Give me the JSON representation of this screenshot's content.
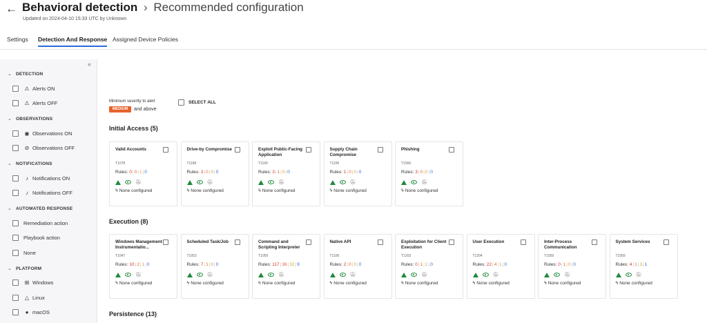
{
  "header": {
    "title": "Behavioral detection",
    "separator": "›",
    "subtitle": "Recommended configuration",
    "updated": "Updated on 2024-04-10 15:33 UTC by Unknown",
    "back_icon": "arrow-left-icon"
  },
  "tabs": [
    {
      "label": "Settings",
      "active": false
    },
    {
      "label": "Detection And Response",
      "active": true
    },
    {
      "label": "Assigned Device Policies",
      "active": false
    }
  ],
  "sidebar": {
    "collapse": "«",
    "sections": [
      {
        "title": "DETECTION",
        "items": [
          {
            "label": "Alerts ON",
            "icon": "warning-icon",
            "glyph": "⚠"
          },
          {
            "label": "Alerts OFF",
            "icon": "warning-off-icon",
            "glyph": "⚠"
          }
        ]
      },
      {
        "title": "OBSERVATIONS",
        "items": [
          {
            "label": "Observations ON",
            "icon": "eye-icon",
            "glyph": "◉"
          },
          {
            "label": "Observations OFF",
            "icon": "eye-off-icon",
            "glyph": "⊘"
          }
        ]
      },
      {
        "title": "NOTIFICATIONS",
        "items": [
          {
            "label": "Notifications ON",
            "icon": "bell-icon",
            "glyph": "♪"
          },
          {
            "label": "Notifications OFF",
            "icon": "bell-off-icon",
            "glyph": "♪"
          }
        ]
      },
      {
        "title": "AUTOMATED RESPONSE",
        "items": [
          {
            "label": "Remediation action",
            "icon": "",
            "glyph": ""
          },
          {
            "label": "Playbook action",
            "icon": "",
            "glyph": ""
          },
          {
            "label": "None",
            "icon": "",
            "glyph": ""
          }
        ]
      },
      {
        "title": "PLATFORM",
        "items": [
          {
            "label": "Windows",
            "icon": "windows-icon",
            "glyph": "⊞"
          },
          {
            "label": "Linux",
            "icon": "linux-icon",
            "glyph": "△"
          },
          {
            "label": "macOS",
            "icon": "apple-icon",
            "glyph": "●"
          }
        ]
      }
    ]
  },
  "severity": {
    "label": "Minimum severity to alert",
    "badge": "MEDIUM",
    "suffix": "and above",
    "select_all": "SELECT ALL"
  },
  "colors": {
    "accent": "#2a6ad8",
    "medium": "#e8622c",
    "green": "#1f8a3b",
    "red": "#d93025",
    "orange": "#e8622c",
    "yellow": "#e0a020",
    "blue": "#2a6ad8"
  },
  "groups": [
    {
      "title": "Initial Access (5)",
      "cards": [
        {
          "name": "Valid Accounts",
          "id": "T1078",
          "rules": [
            "0",
            "0",
            "1",
            "0"
          ]
        },
        {
          "name": "Drive-by Compromise",
          "id": "T1189",
          "rules": [
            "3",
            "0",
            "0",
            "0"
          ]
        },
        {
          "name": "Exploit Public-Facing Application",
          "id": "T1190",
          "rules": [
            "3",
            "1",
            "0",
            "0"
          ]
        },
        {
          "name": "Supply Chain Compromise",
          "id": "T1195",
          "rules": [
            "1",
            "0",
            "0",
            "0"
          ]
        },
        {
          "name": "Phishing",
          "id": "T1566",
          "rules": [
            "3",
            "0",
            "0",
            "0"
          ]
        }
      ]
    },
    {
      "title": "Execution (8)",
      "cards": [
        {
          "name": "Windows Management Instrumentatio...",
          "id": "T1047",
          "rules": [
            "10",
            "2",
            "1",
            "0"
          ]
        },
        {
          "name": "Scheduled Task/Job",
          "id": "T1053",
          "rules": [
            "7",
            "1",
            "0",
            "0"
          ]
        },
        {
          "name": "Command and Scripting Interpreter",
          "id": "T1059",
          "rules": [
            "117",
            "36",
            "32",
            "9"
          ]
        },
        {
          "name": "Native API",
          "id": "T1106",
          "rules": [
            "2",
            "0",
            "0",
            "0"
          ]
        },
        {
          "name": "Exploitation for Client Execution",
          "id": "T1203",
          "rules": [
            "0",
            "1",
            "1",
            "0"
          ]
        },
        {
          "name": "User Execution",
          "id": "T1204",
          "rules": [
            "22",
            "4",
            "1",
            "0"
          ]
        },
        {
          "name": "Inter-Process Communication",
          "id": "T1559",
          "rules": [
            "0",
            "1",
            "0",
            "0"
          ]
        },
        {
          "name": "System Services",
          "id": "T1569",
          "rules": [
            "4",
            "1",
            "3",
            "1"
          ]
        }
      ]
    },
    {
      "title": "Persistence (13)",
      "cards": []
    }
  ],
  "card_labels": {
    "rules_prefix": "Rules:",
    "response": "None configured"
  }
}
